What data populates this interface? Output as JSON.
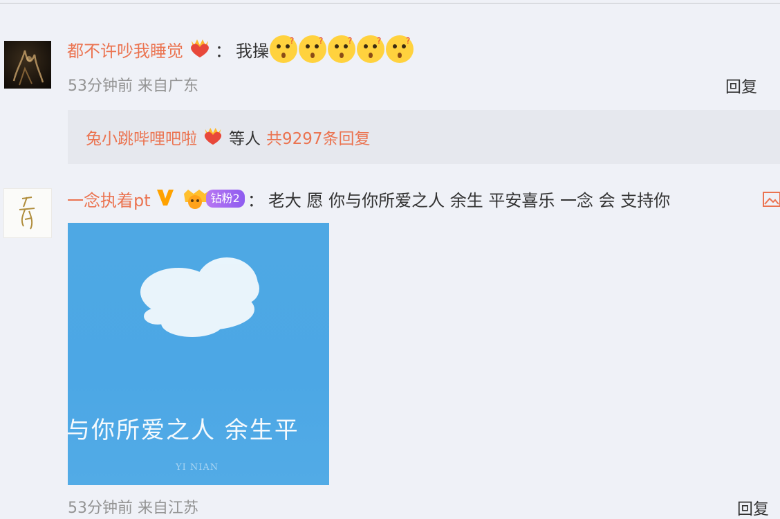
{
  "comments": [
    {
      "username": "都不许吵我睡觉",
      "colon": "：",
      "content": "我操",
      "emoji_count": 5,
      "meta": "53分钟前 来自广东",
      "reply_label": "回复",
      "sub_replies": {
        "name": "兔小跳哔哩吧啦",
        "etc": "等人",
        "count_text": "共9297条回复"
      }
    },
    {
      "username": "一念执着pt",
      "fan_badge": "钻粉2",
      "colon": "：",
      "content": "老大 愿 你与你所爱之人 余生 平安喜乐 一念 会 支持你",
      "image_caption": "与你所爱之人 余生平",
      "image_watermark": "YI NIAN",
      "meta": "53分钟前 来自江苏",
      "reply_label": "回复"
    }
  ],
  "colors": {
    "username": "#eb7350",
    "background": "#eff1f7",
    "sub_reply_bg": "#e6e8ee",
    "image_sky": "#4ea8e4",
    "fan_badge": "#a06af2",
    "verified": "#ffa200"
  },
  "icons": [
    "heart-crown-badge-icon",
    "surprised-emoji-icon",
    "verified-v-icon",
    "diamond-fan-icon",
    "image-icon"
  ]
}
